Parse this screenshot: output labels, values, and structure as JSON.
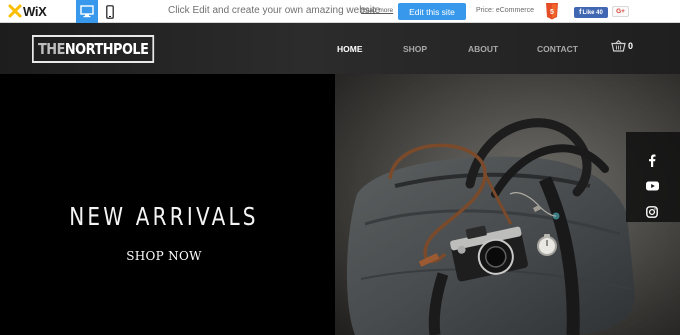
{
  "editor_bar": {
    "logo_text": "WiX",
    "message": "Click Edit and create your own amazing website",
    "read_more": "Read more",
    "edit_button": "Edit this site",
    "price": "Price: eCommerce",
    "fb_like": "Like 40",
    "gplus": "G+"
  },
  "site": {
    "logo_prefix": "THE",
    "logo_main": "NORTHPOLE",
    "nav": [
      {
        "label": "HOME",
        "active": true
      },
      {
        "label": "SHOP"
      },
      {
        "label": "ABOUT"
      },
      {
        "label": "CONTACT"
      }
    ],
    "cart_count": "0"
  },
  "hero": {
    "title": "NEW ARRIVALS",
    "cta": "SHOP NOW"
  },
  "social": [
    "facebook-icon",
    "youtube-icon",
    "instagram-icon"
  ],
  "colors": {
    "editor_accent": "#3899ec",
    "header_bg": "#262626",
    "hero_left_bg": "#000000"
  }
}
